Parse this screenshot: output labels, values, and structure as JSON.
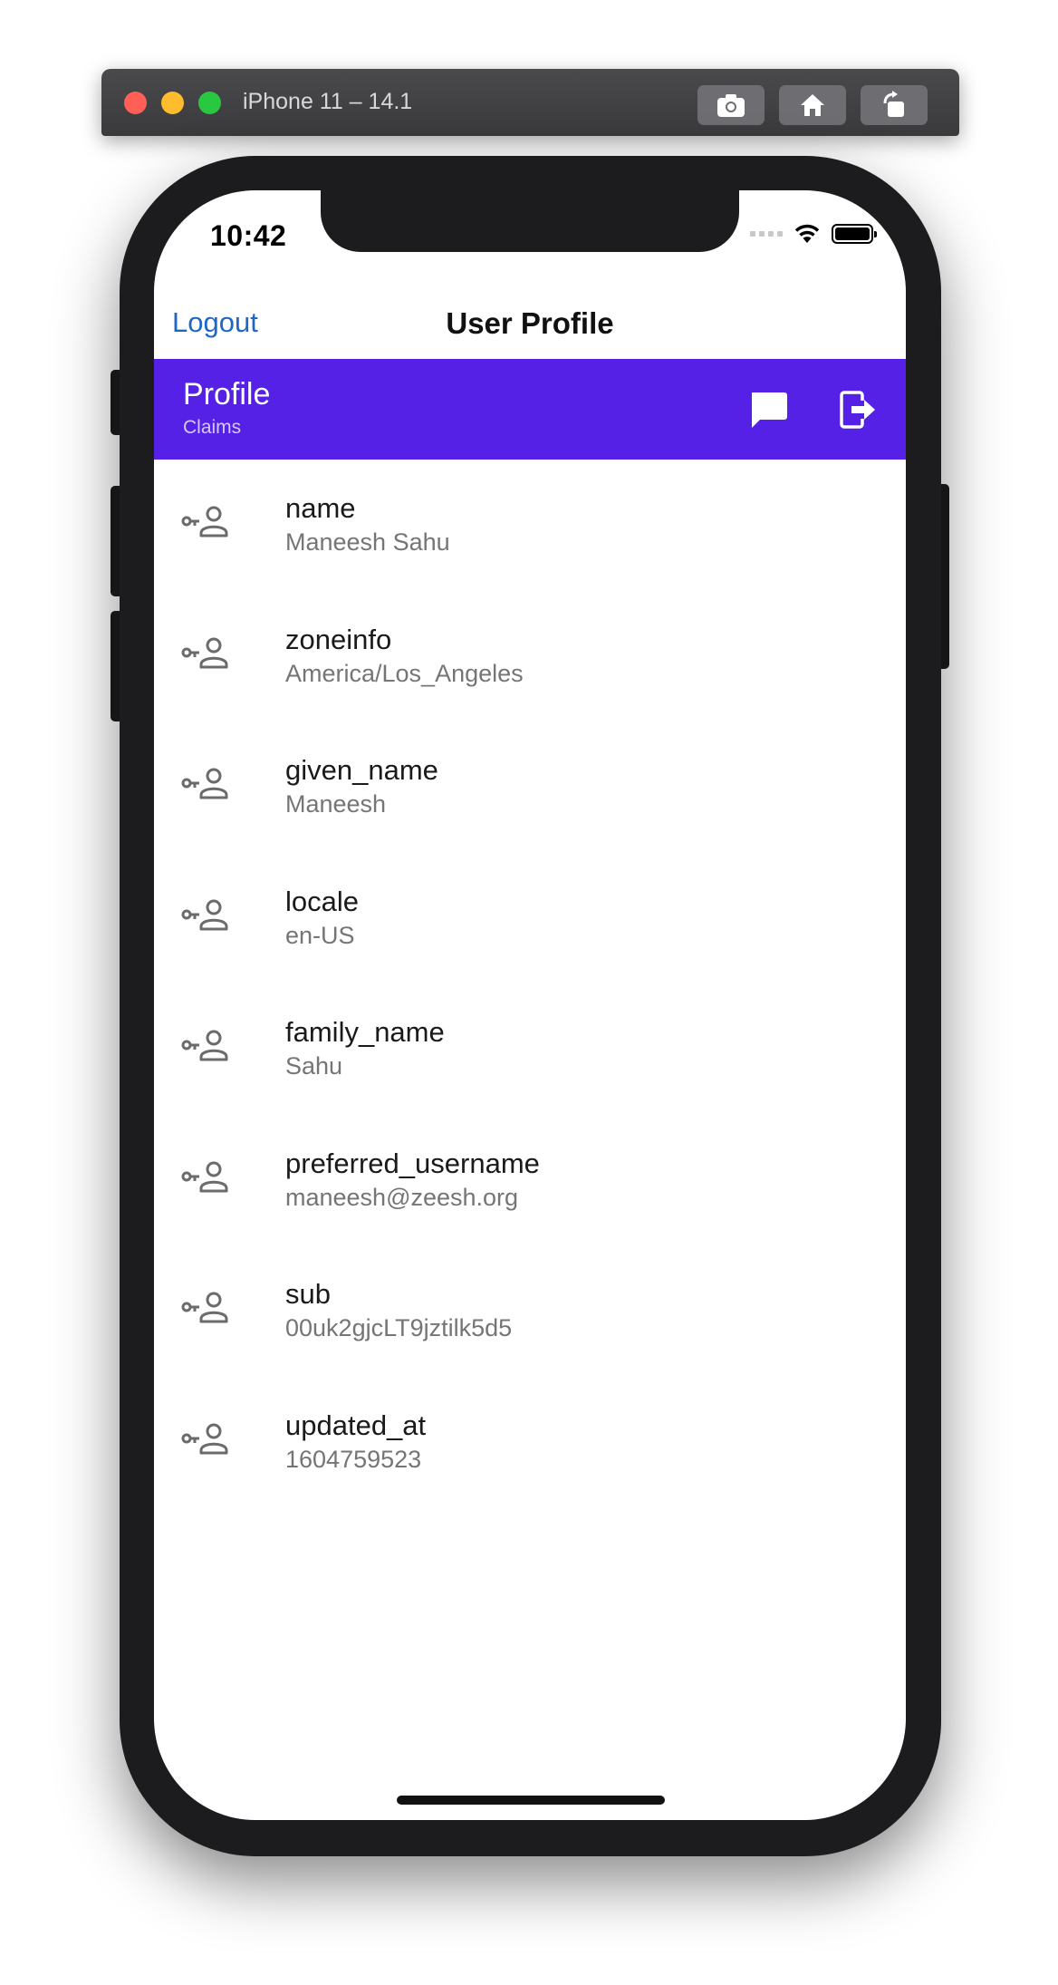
{
  "simulator": {
    "title": "iPhone 11 – 14.1",
    "buttons": [
      "screenshot-icon",
      "home-icon",
      "rotate-icon"
    ]
  },
  "status_bar": {
    "time": "10:42"
  },
  "nav": {
    "left_button": "Logout",
    "title": "User Profile"
  },
  "header": {
    "title": "Profile",
    "subtitle": "Claims",
    "color": "#5621e6"
  },
  "claims": [
    {
      "name": "name",
      "value": "Maneesh Sahu"
    },
    {
      "name": "zoneinfo",
      "value": "America/Los_Angeles"
    },
    {
      "name": "given_name",
      "value": "Maneesh"
    },
    {
      "name": "locale",
      "value": "en-US"
    },
    {
      "name": "family_name",
      "value": "Sahu"
    },
    {
      "name": "preferred_username",
      "value": "maneesh@zeesh.org"
    },
    {
      "name": "sub",
      "value": "00uk2gjcLT9jztilk5d5"
    },
    {
      "name": "updated_at",
      "value": "1604759523"
    }
  ]
}
